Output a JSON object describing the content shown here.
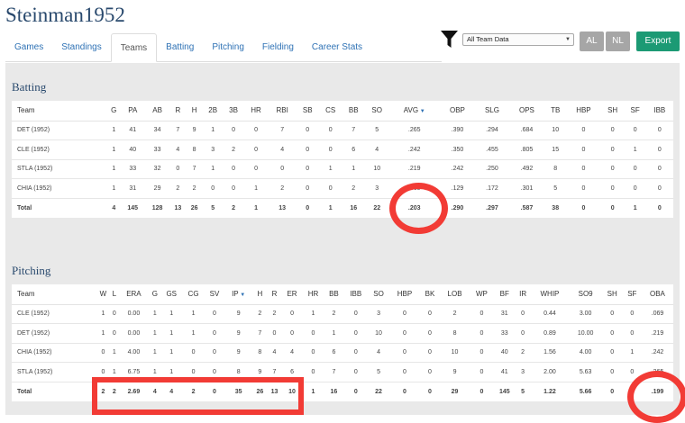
{
  "page": {
    "title": "Steinman1952"
  },
  "tabs": [
    {
      "label": "Games",
      "active": false
    },
    {
      "label": "Standings",
      "active": false
    },
    {
      "label": "Teams",
      "active": true
    },
    {
      "label": "Batting",
      "active": false
    },
    {
      "label": "Pitching",
      "active": false
    },
    {
      "label": "Fielding",
      "active": false
    },
    {
      "label": "Career Stats",
      "active": false
    }
  ],
  "toolbar": {
    "filter_select_value": "All Team Data",
    "al_label": "AL",
    "nl_label": "NL",
    "export_label": "Export",
    "icons": [
      "filter-icon",
      "chevron-down-icon",
      "sort-desc-icon"
    ]
  },
  "colors": {
    "accent_blue": "#2f72b5",
    "title_navy": "#2a4a6e",
    "export_green": "#1c9a74",
    "disabled_gray": "#a6a6a6",
    "annotation_red": "#f23b35",
    "panel_bg": "#e9e9e9"
  },
  "batting": {
    "title": "Batting",
    "sort_column": "AVG",
    "columns": [
      "Team",
      "G",
      "PA",
      "AB",
      "R",
      "H",
      "2B",
      "3B",
      "HR",
      "RBI",
      "SB",
      "CS",
      "BB",
      "SO",
      "AVG",
      "OBP",
      "SLG",
      "OPS",
      "TB",
      "HBP",
      "SH",
      "SF",
      "IBB"
    ],
    "rows": [
      [
        "DET (1952)",
        "1",
        "41",
        "34",
        "7",
        "9",
        "1",
        "0",
        "0",
        "7",
        "0",
        "0",
        "7",
        "5",
        ".265",
        ".390",
        ".294",
        ".684",
        "10",
        "0",
        "0",
        "0",
        "0"
      ],
      [
        "CLE (1952)",
        "1",
        "40",
        "33",
        "4",
        "8",
        "3",
        "2",
        "0",
        "4",
        "0",
        "0",
        "6",
        "4",
        ".242",
        ".350",
        ".455",
        ".805",
        "15",
        "0",
        "0",
        "1",
        "0"
      ],
      [
        "STLA (1952)",
        "1",
        "33",
        "32",
        "0",
        "7",
        "1",
        "0",
        "0",
        "0",
        "0",
        "1",
        "1",
        "10",
        ".219",
        ".242",
        ".250",
        ".492",
        "8",
        "0",
        "0",
        "0",
        "0"
      ],
      [
        "CHIA (1952)",
        "1",
        "31",
        "29",
        "2",
        "2",
        "0",
        "0",
        "1",
        "2",
        "0",
        "0",
        "2",
        "3",
        ".069",
        ".129",
        ".172",
        ".301",
        "5",
        "0",
        "0",
        "0",
        "0"
      ]
    ],
    "total": [
      "Total",
      "4",
      "145",
      "128",
      "13",
      "26",
      "5",
      "2",
      "1",
      "13",
      "0",
      "1",
      "16",
      "22",
      ".203",
      ".290",
      ".297",
      ".587",
      "38",
      "0",
      "0",
      "1",
      "0"
    ]
  },
  "pitching": {
    "title": "Pitching",
    "sort_column": "IP",
    "columns": [
      "Team",
      "W",
      "L",
      "ERA",
      "G",
      "GS",
      "CG",
      "SV",
      "IP",
      "H",
      "R",
      "ER",
      "HR",
      "BB",
      "IBB",
      "SO",
      "HBP",
      "BK",
      "LOB",
      "WP",
      "BF",
      "IR",
      "WHIP",
      "SO9",
      "SH",
      "SF",
      "OBA"
    ],
    "rows": [
      [
        "CLE (1952)",
        "1",
        "0",
        "0.00",
        "1",
        "1",
        "1",
        "0",
        "9",
        "2",
        "2",
        "0",
        "1",
        "2",
        "0",
        "3",
        "0",
        "0",
        "2",
        "0",
        "31",
        "0",
        "0.44",
        "3.00",
        "0",
        "0",
        ".069"
      ],
      [
        "DET (1952)",
        "1",
        "0",
        "0.00",
        "1",
        "1",
        "1",
        "0",
        "9",
        "7",
        "0",
        "0",
        "0",
        "1",
        "0",
        "10",
        "0",
        "0",
        "8",
        "0",
        "33",
        "0",
        "0.89",
        "10.00",
        "0",
        "0",
        ".219"
      ],
      [
        "CHIA (1952)",
        "0",
        "1",
        "4.00",
        "1",
        "1",
        "0",
        "0",
        "9",
        "8",
        "4",
        "4",
        "0",
        "6",
        "0",
        "4",
        "0",
        "0",
        "10",
        "0",
        "40",
        "2",
        "1.56",
        "4.00",
        "0",
        "1",
        ".242"
      ],
      [
        "STLA (1952)",
        "0",
        "1",
        "6.75",
        "1",
        "1",
        "0",
        "0",
        "8",
        "9",
        "7",
        "6",
        "0",
        "7",
        "0",
        "5",
        "0",
        "0",
        "9",
        "0",
        "41",
        "3",
        "2.00",
        "5.63",
        "0",
        "0",
        ".265"
      ]
    ],
    "total": [
      "Total",
      "2",
      "2",
      "2.69",
      "4",
      "4",
      "2",
      "0",
      "35",
      "26",
      "13",
      "10",
      "1",
      "16",
      "0",
      "22",
      "0",
      "0",
      "29",
      "0",
      "145",
      "5",
      "1.22",
      "5.66",
      "0",
      "1",
      ".199"
    ]
  }
}
